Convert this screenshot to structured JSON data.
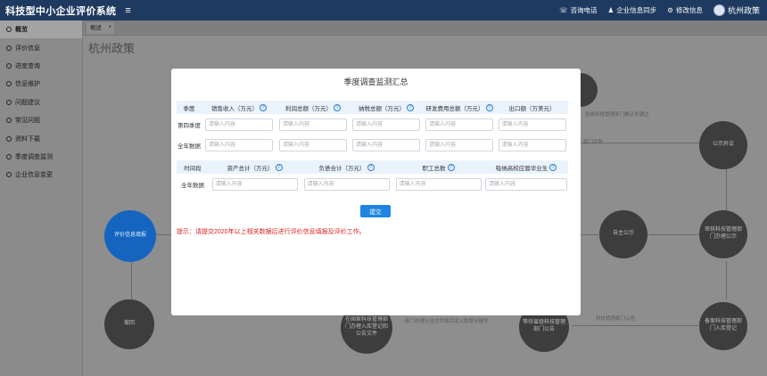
{
  "app": {
    "title": "科技型中小企业评价系统",
    "menu_icon": "menu-icon"
  },
  "topbar": {
    "items": [
      {
        "icon": "phone-icon",
        "label": "咨询电话"
      },
      {
        "icon": "user-icon",
        "label": "企业信息同步"
      },
      {
        "icon": "gear-icon",
        "label": "修改信息"
      }
    ],
    "user_name": "杭州政策"
  },
  "sidebar": {
    "items": [
      {
        "label": "概览",
        "active": true
      },
      {
        "label": "评价信息"
      },
      {
        "label": "进度查询"
      },
      {
        "label": "信息维护"
      },
      {
        "label": "问题建议"
      },
      {
        "label": "常见问题"
      },
      {
        "label": "资料下载"
      },
      {
        "label": "季度调查监测"
      },
      {
        "label": "企业信息变更"
      }
    ]
  },
  "tabs": [
    {
      "label": "概述",
      "close": "×"
    }
  ],
  "page_title": "杭州政策",
  "flow": {
    "nodes": [
      "评价信息填报",
      "自主公示",
      "审核科技管理部门办理公示",
      "备案科技管理部门入库登记",
      "等待省级科技管理部门公告",
      "在国家科技管理部门办理入库登记和公告文件",
      "撤回",
      "公示异议"
    ],
    "labels": [
      "省级科技管理部门确认并通过",
      "科技管理部门公告",
      "部门并联",
      "部门办理公告文件和完成入库登记编号"
    ]
  },
  "modal": {
    "title": "季度调查监测汇总",
    "table1": {
      "headers": [
        "季度",
        "销售收入（万元）",
        "利润总额（万元）",
        "纳税总额（万元）",
        "研发费用总额（万元）",
        "出口额（万美元）"
      ],
      "rows": [
        {
          "label": "第四季度",
          "placeholders": [
            "请输入内容",
            "请输入内容",
            "请输入内容",
            "请输入内容",
            "请输入内容"
          ]
        },
        {
          "label": "全年数据",
          "placeholders": [
            "请输入内容",
            "请输入内容",
            "请输入内容",
            "请输入内容",
            "请输入内容"
          ]
        }
      ]
    },
    "table2": {
      "headers": [
        "时间段",
        "资产总计（万元）",
        "负债合计（万元）",
        "职工总数",
        "吸纳高校应届毕业生"
      ],
      "rows": [
        {
          "label": "全年数据",
          "placeholders": [
            "请输入内容",
            "请输入内容",
            "请输入内容",
            "请输入内容"
          ]
        }
      ]
    },
    "submit_label": "提交",
    "tip": "提示：请提交2020年以上相关数据后进行评价信息填报及评价工作。"
  }
}
